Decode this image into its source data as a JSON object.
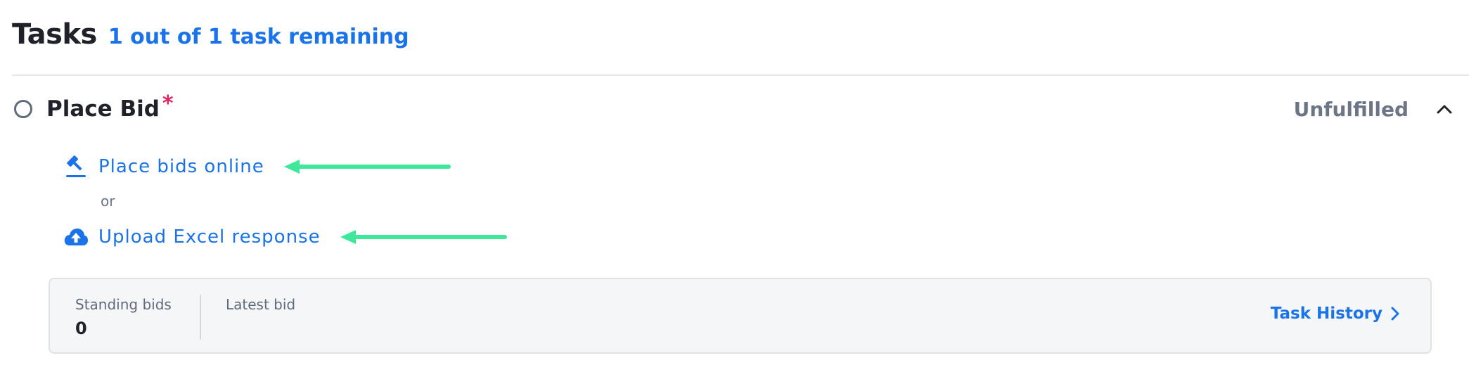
{
  "header": {
    "title": "Tasks",
    "remaining": "1 out of 1 task remaining"
  },
  "task": {
    "title": "Place Bid",
    "required_mark": "*",
    "status": "Unfulfilled",
    "status_icon": "circle-outline-icon",
    "toggle_icon": "chevron-up-icon"
  },
  "options": {
    "place_online": {
      "label": "Place bids online",
      "icon": "gavel-icon"
    },
    "separator": "or",
    "upload_excel": {
      "label": "Upload Excel response",
      "icon": "cloud-upload-icon"
    }
  },
  "stats": {
    "standing_bids_label": "Standing bids",
    "standing_bids_value": "0",
    "latest_bid_label": "Latest bid",
    "latest_bid_value": "",
    "task_history_label": "Task History",
    "task_history_icon": "chevron-right-icon"
  },
  "colors": {
    "link": "#1a73e8",
    "required": "#e0245e",
    "annotation_arrow": "#3de89a",
    "card_background": "#f5f6f8"
  }
}
